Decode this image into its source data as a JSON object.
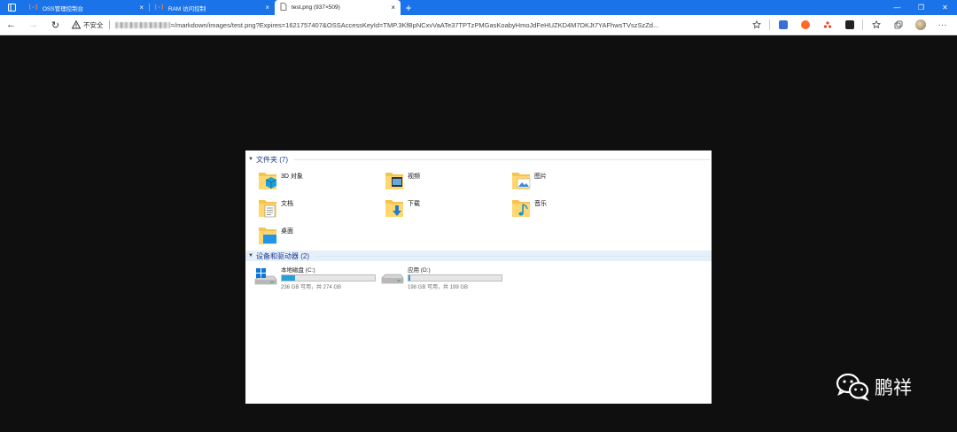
{
  "tabs": [
    {
      "label": "OSS管理控制台",
      "favicon": "[-]",
      "close": "×"
    },
    {
      "label": "RAM 访问控制",
      "favicon": "[-]",
      "close": "×"
    },
    {
      "label": "test.png (937×509)",
      "close": "×"
    }
  ],
  "newtab": "+",
  "window_controls": [
    "—",
    "❐",
    "✕"
  ],
  "nav": {
    "back": "←",
    "forward": "→",
    "reload": "↻"
  },
  "address": {
    "security_label": "不安全",
    "url_visible": "=/markdown/images/test.png?Expires=1621757407&OSSAccessKeyId=TMP.3KfBpNCxvVaATe37TPTzPMGasKoabyHmoJdFeHUZKD4M7DKJt7YAFhwsTVszSzZd..."
  },
  "toolbar_icons": [
    "star-add-icon",
    "ext-blue-icon",
    "ext-orange-icon",
    "ext-red-icon",
    "ext-dark-icon",
    "favorites-icon",
    "collections-icon",
    "avatar",
    "menu-icon"
  ],
  "explorer": {
    "folders_header": "文件夹 (7)",
    "folders": [
      {
        "label": "3D 对象",
        "icon": "3d-objects-folder-icon"
      },
      {
        "label": "视频",
        "icon": "videos-folder-icon"
      },
      {
        "label": "图片",
        "icon": "pictures-folder-icon"
      },
      {
        "label": "文档",
        "icon": "documents-folder-icon"
      },
      {
        "label": "下载",
        "icon": "downloads-folder-icon"
      },
      {
        "label": "音乐",
        "icon": "music-folder-icon"
      },
      {
        "label": "桌面",
        "icon": "desktop-folder-icon"
      }
    ],
    "drives_header": "设备和驱动器 (2)",
    "drives": [
      {
        "label": "本地磁盘 (C:)",
        "free_text": "236 GB 可用，共 274 GB",
        "used_fraction": 0.14,
        "icon": "windows-drive-icon"
      },
      {
        "label": "应用 (D:)",
        "free_text": "198 GB 可用，共 199 GB",
        "used_fraction": 0.01,
        "icon": "drive-icon"
      }
    ]
  },
  "watermark": {
    "text": "鹏祥",
    "icon": "wechat-icon"
  },
  "colors": {
    "tab_strip": "#1a73e8",
    "viewport": "#0f0f0f",
    "drive_fill": "#26a0da",
    "group_header_text": "#1e3a8a"
  }
}
